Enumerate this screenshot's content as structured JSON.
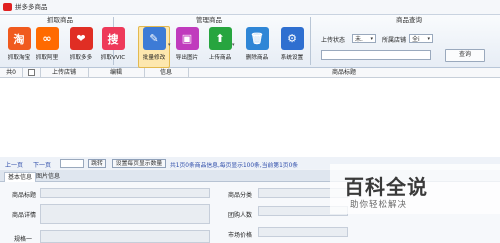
{
  "window": {
    "title": "拼多多商品"
  },
  "ribbon": {
    "groups": {
      "grab": "抓取商品",
      "manage": "管理商品",
      "query": "商品查询"
    },
    "buttons": [
      {
        "label": "抓取淘宝",
        "glyph": "淘",
        "color": "#f05a1e"
      },
      {
        "label": "抓取阿里",
        "glyph": "∞",
        "color": "#ff6a00"
      },
      {
        "label": "抓取多多",
        "glyph": "❤",
        "color": "#e02e24"
      },
      {
        "label": "抓取VVIC",
        "glyph": "搜",
        "color": "#ee3a5a"
      },
      {
        "label": "批量修改",
        "glyph": "✎",
        "color": "#3d7bd6"
      },
      {
        "label": "导出图片",
        "glyph": "▣",
        "color": "#c03bbd"
      },
      {
        "label": "上传商品",
        "glyph": "⬆",
        "color": "#27a53f"
      },
      {
        "label": "删除商品",
        "glyph": "🗑",
        "color": "#2f86d6"
      },
      {
        "label": "系统设置",
        "glyph": "⚙",
        "color": "#2f6fd0"
      }
    ],
    "query": {
      "upload_status_label": "上传状态",
      "upload_status_value": "未.",
      "store_label": "所属店铺",
      "store_value": "全i",
      "search_value": "",
      "query_button": "查询"
    }
  },
  "table": {
    "columns": [
      "共0",
      "",
      "上传店铺",
      "编辑",
      "信息",
      "商品标题"
    ]
  },
  "pager": {
    "prev": "上一页",
    "next": "下一页",
    "page_value": "",
    "jump": "跳转",
    "set_count": "设置每页显示数量",
    "info": "共1页0条商品信息,每页显示100条,当前第1页0条"
  },
  "tabs": [
    "基本信息",
    "图片信息"
  ],
  "detail": {
    "fields_left": [
      "商品标题",
      "商品详情",
      "规格一"
    ],
    "fields_right": [
      "商品分类",
      "团购人数",
      "市场价格"
    ]
  },
  "watermark": {
    "title": "百科全说",
    "subtitle": "助你轻松解决"
  }
}
